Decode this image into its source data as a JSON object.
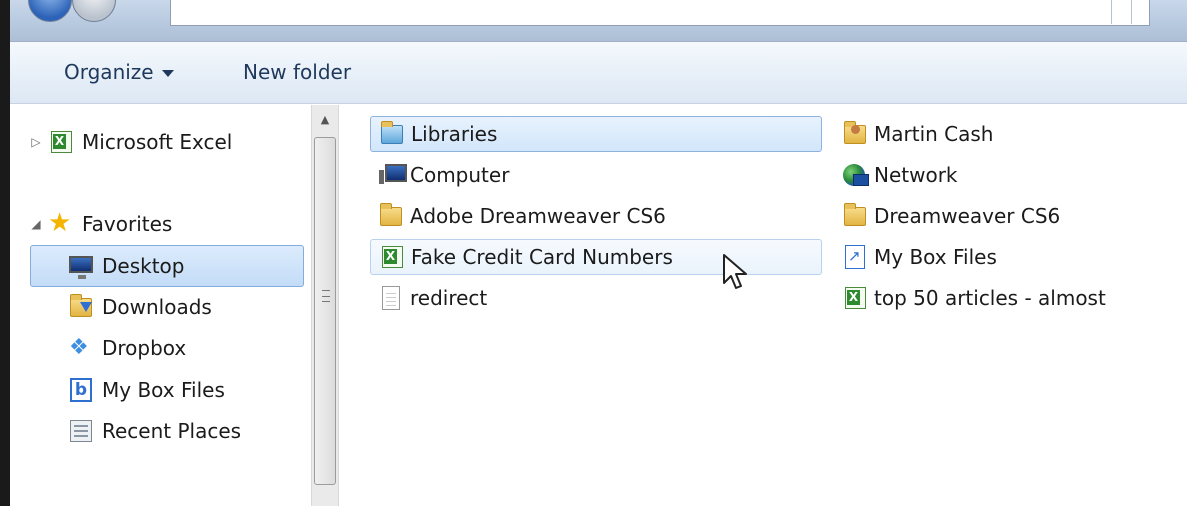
{
  "toolbar": {
    "organize_label": "Organize",
    "new_folder_label": "New folder"
  },
  "navigation": {
    "items": [
      {
        "label": "Microsoft Excel",
        "icon": "excel-icon"
      },
      {
        "label": "Favorites",
        "icon": "star-icon"
      },
      {
        "label": "Desktop",
        "icon": "desktop-icon",
        "selected": true
      },
      {
        "label": "Downloads",
        "icon": "downloads-folder-icon"
      },
      {
        "label": "Dropbox",
        "icon": "dropbox-icon"
      },
      {
        "label": "My Box Files",
        "icon": "box-icon"
      },
      {
        "label": "Recent Places",
        "icon": "recent-places-icon"
      }
    ]
  },
  "content": {
    "items": [
      {
        "label": "Libraries",
        "icon": "libraries-folder-icon"
      },
      {
        "label": "Computer",
        "icon": "computer-icon"
      },
      {
        "label": "Adobe Dreamweaver CS6",
        "icon": "folder-icon"
      },
      {
        "label": "Fake Credit Card Numbers",
        "icon": "excel-file-icon"
      },
      {
        "label": "redirect",
        "icon": "text-file-icon"
      },
      {
        "label": "Martin Cash",
        "icon": "user-folder-icon"
      },
      {
        "label": "Network",
        "icon": "network-icon"
      },
      {
        "label": "Dreamweaver CS6",
        "icon": "folder-icon"
      },
      {
        "label": "My Box Files",
        "icon": "box-shortcut-icon"
      },
      {
        "label": "top 50 articles - almost",
        "icon": "excel-file-icon"
      }
    ]
  },
  "colors": {
    "accent": "#1e395b",
    "selection_border": "#84acdd",
    "selection_fill": "#c3dcf7"
  }
}
